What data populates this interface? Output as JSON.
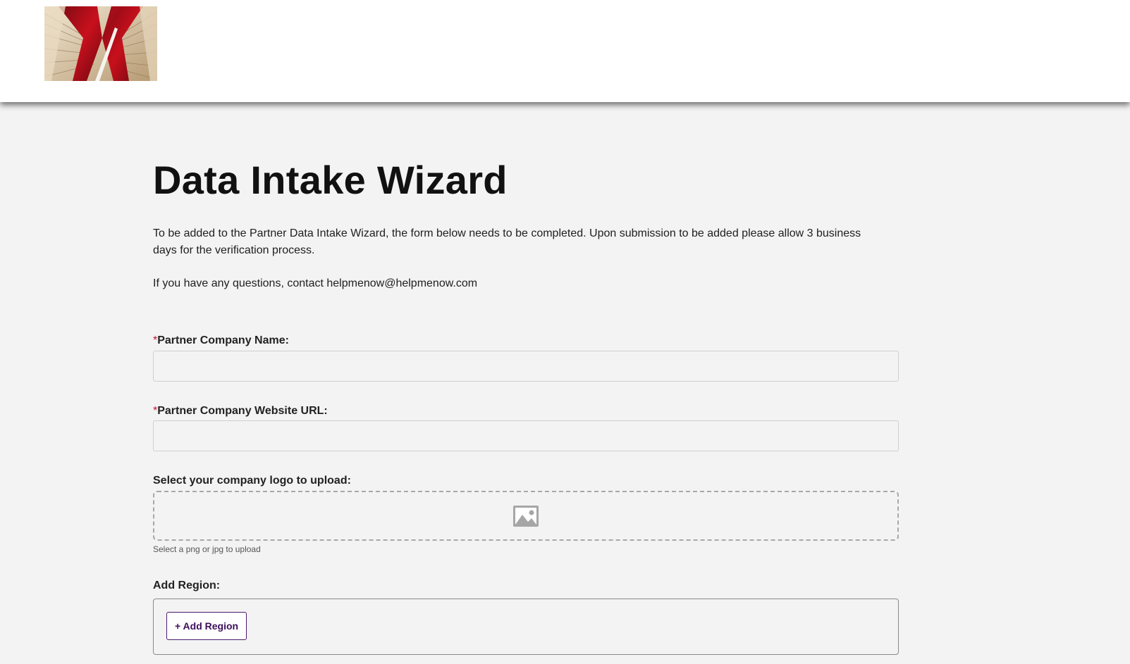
{
  "header": {
    "logo_icon": "red-abstract-book-logo"
  },
  "page": {
    "title": "Data Intake Wizard",
    "intro": "To be added to the Partner Data Intake Wizard, the form below needs to be completed. Upon submission to be added please allow 3 business days for the verification process.",
    "contact": "If you have any questions, contact helpmenow@helpmenow.com"
  },
  "form": {
    "required_marker": "*",
    "company_name": {
      "label": "Partner Company Name:",
      "value": "",
      "placeholder": ""
    },
    "company_url": {
      "label": "Partner Company Website URL:",
      "value": "",
      "placeholder": ""
    },
    "logo_upload": {
      "label": "Select your company logo to upload:",
      "icon": "image-placeholder-icon",
      "hint": "Select a png or jpg to upload"
    },
    "region": {
      "label": "Add Region:",
      "button_label": "+ Add Region"
    }
  },
  "colors": {
    "required": "#c8102e",
    "button_accent": "#4b1a6e",
    "background": "#f3f3f3"
  }
}
